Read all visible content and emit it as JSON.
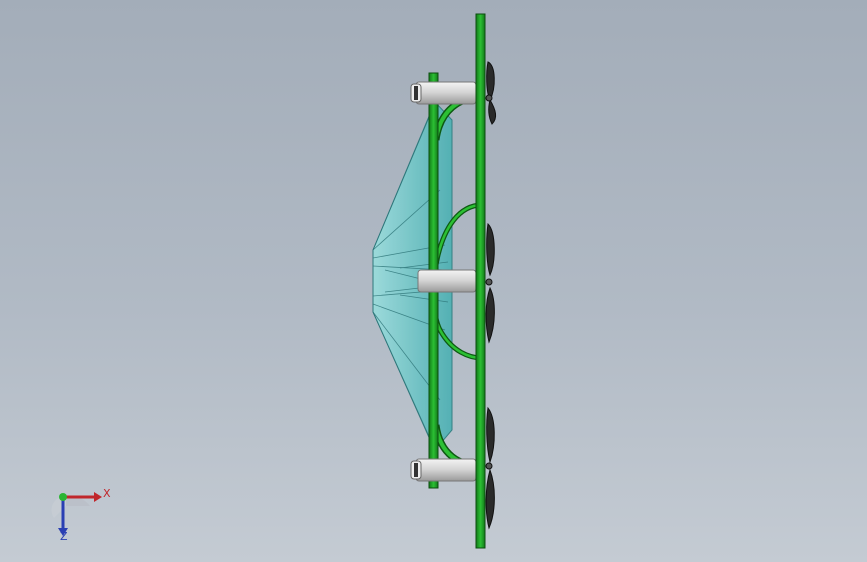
{
  "viewport": {
    "background_top": "#a3adb9",
    "background_bottom": "#c4cbd3"
  },
  "model": {
    "green_color": "#1f9e27",
    "green_dark": "#0d5a12",
    "glass_color": "#6fc3c4",
    "metal_color": "#dcdcdc",
    "blade_color": "#2a2a2a"
  },
  "triad": {
    "x_label": "X",
    "z_label": "Z",
    "x_color": "#c0262b",
    "z_color": "#2a3fb3",
    "y_color": "#2bb534"
  }
}
